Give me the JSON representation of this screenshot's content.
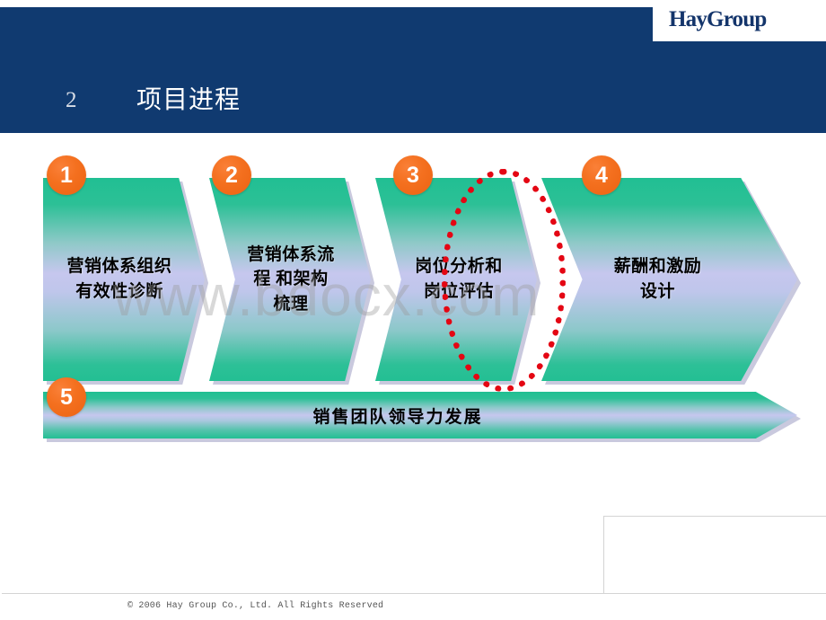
{
  "header": {
    "logo_text": "HayGroup",
    "band_color": "#103A70",
    "title_number": "2",
    "title_text": "项目进程"
  },
  "watermark": {
    "text": "www.bdocx.com"
  },
  "process": {
    "accent_color": "#F2691C",
    "chevron_green": "#21BF93",
    "chevron_lavender": "#C6C7EE",
    "steps": [
      {
        "number": "1",
        "label": "营销体系组织\n有效性诊断"
      },
      {
        "number": "2",
        "label": "营销体系流\n程  和架构\n梳理"
      },
      {
        "number": "3",
        "label": "岗位分析和\n岗位评估"
      },
      {
        "number": "4",
        "label": "薪酬和激励\n设计"
      }
    ],
    "bottom_bar": {
      "number": "5",
      "label": "销售团队领导力发展"
    },
    "highlight": {
      "target_step": "3",
      "shape": "dotted-ellipse",
      "color": "#E40613"
    }
  },
  "footer": {
    "copyright": "© 2006 Hay Group Co., Ltd. All Rights Reserved"
  }
}
